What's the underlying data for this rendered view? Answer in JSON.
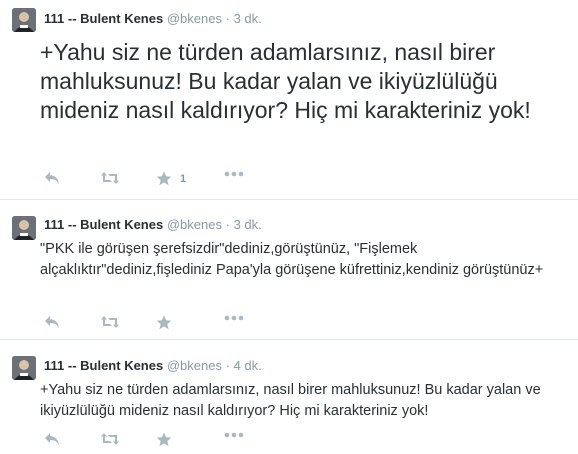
{
  "tweets": [
    {
      "author_name": "111 -- Bulent Kenes",
      "handle": "@bkenes",
      "separator": "·",
      "time": "3 dk.",
      "text": "+Yahu siz ne türden adamlarsınız, nasıl birer mahluksunuz! Bu kadar yalan ve ikiyüzlülüğü mideniz nasıl kaldırıyor? Hiç mi karakteriniz yok!",
      "favorite_count": "1"
    },
    {
      "author_name": "111 -- Bulent Kenes",
      "handle": "@bkenes",
      "separator": "·",
      "time": "3 dk.",
      "text": "\"PKK ile görüşen şerefsizdir\"dediniz,görüştünüz, \"Fişlemek alçaklıktır\"dediniz,fişlediniz Papa'yla görüşene küfrettiniz,kendiniz görüştünüz+",
      "favorite_count": ""
    },
    {
      "author_name": "111 -- Bulent Kenes",
      "handle": "@bkenes",
      "separator": "·",
      "time": "4 dk.",
      "text": "+Yahu siz ne türden adamlarsınız, nasıl birer mahluksunuz! Bu kadar yalan ve ikiyüzlülüğü mideniz nasıl kaldırıyor? Hiç mi karakteriniz yok!",
      "favorite_count": ""
    }
  ],
  "icons": {
    "reply": "reply-icon",
    "retweet": "retweet-icon",
    "favorite": "star-icon",
    "more": "more-icon"
  },
  "colors": {
    "text": "#292f33",
    "muted": "#8899a6",
    "icon": "#aab8c2",
    "divider": "#e1e8ed"
  }
}
